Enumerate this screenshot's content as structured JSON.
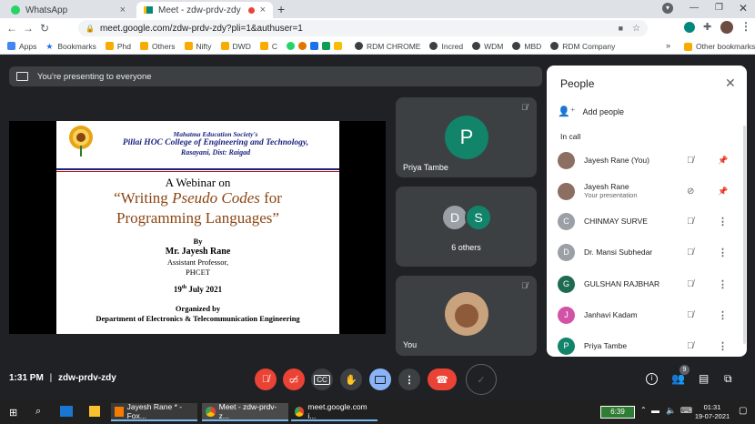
{
  "browser": {
    "tabs": [
      {
        "title": "WhatsApp"
      },
      {
        "title": "Meet - zdw-prdv-zdy"
      }
    ],
    "url": "meet.google.com/zdw-prdv-zdy?pli=1&authuser=1",
    "bookmarks": [
      "Apps",
      "Bookmarks",
      "Phd",
      "Others",
      "Nifty",
      "DWD",
      "C",
      "Incred",
      "WDM",
      "MBD",
      "RDM Company",
      "RDM CHROME"
    ],
    "other_bookmarks": "Other bookmarks"
  },
  "meet": {
    "presenting_banner": "You're presenting to everyone",
    "slide": {
      "society": "Mahatma Education Society's",
      "college": "Pillai HOC College of Engineering and Technology,",
      "location": "Rasayani, Dist: Raigad",
      "webinar_on": "A Webinar on",
      "title_line1_a": "“Writing ",
      "title_line1_b": "Pseudo Codes",
      "title_line1_c": " for",
      "title_line2": "Programming Languages”",
      "by": "By",
      "speaker": "Mr. Jayesh Rane",
      "role": "Assistant Professor,",
      "dept_short": "PHCET",
      "date_day": "19",
      "date_sup": "th",
      "date_rest": " July 2021",
      "organized_by": "Organized by",
      "organizer": "Department of Electronics & Telecommunication Engineering"
    },
    "tiles": {
      "priya": {
        "initial": "P",
        "name": "Priya Tambe"
      },
      "others": {
        "initial_a": "D",
        "initial_b": "S",
        "label": "6 others"
      },
      "you": {
        "name": "You"
      }
    },
    "bottom": {
      "time": "1:31 PM",
      "separator": "|",
      "meeting_code": "zdw-prdv-zdy",
      "people_badge": "9"
    }
  },
  "people_panel": {
    "title": "People",
    "add_people": "Add people",
    "section": "In call",
    "participants": [
      {
        "name": "Jayesh Rane (You)",
        "sub": "",
        "initial": "",
        "color": "#8d6e63"
      },
      {
        "name": "Jayesh Rane",
        "sub": "Your presentation",
        "initial": "",
        "color": "#8d6e63"
      },
      {
        "name": "CHINMAY SURVE",
        "sub": "",
        "initial": "C",
        "color": "#9aa0a6"
      },
      {
        "name": "Dr. Mansi Subhedar",
        "sub": "",
        "initial": "D",
        "color": "#9aa0a6"
      },
      {
        "name": "GULSHAN RAJBHAR",
        "sub": "",
        "initial": "G",
        "color": "#1e6b52"
      },
      {
        "name": "Janhavi Kadam",
        "sub": "",
        "initial": "J",
        "color": "#d252a6"
      },
      {
        "name": "Priya Tambe",
        "sub": "",
        "initial": "P",
        "color": "#12846a"
      }
    ]
  },
  "taskbar": {
    "items": [
      "Jayesh Rane * - Fox...",
      "Meet - zdw-prdv-z...",
      "meet.google.com i..."
    ],
    "battery": "6:39",
    "clock_time": "01:31",
    "clock_date": "19-07-2021"
  }
}
